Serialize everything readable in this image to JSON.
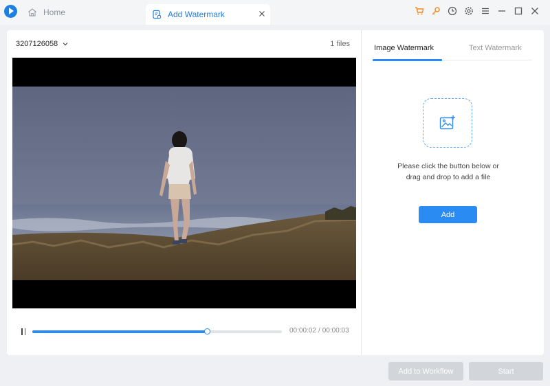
{
  "titlebar": {
    "home_tab": {
      "label": "Home",
      "icon": "home-icon"
    },
    "active_tab": {
      "label": "Add Watermark",
      "icon": "watermark-icon"
    },
    "icons": [
      "cart-icon",
      "key-icon",
      "clock-icon",
      "gear-icon",
      "menu-icon",
      "minimize-icon",
      "maximize-icon",
      "close-icon"
    ],
    "accent": "#f08a24"
  },
  "editor": {
    "file_name": "3207126058",
    "file_count": "1 files",
    "playback": {
      "progress": 0.7,
      "current_time": "00:00:02",
      "separator": "/",
      "total_time": "00:00:03"
    }
  },
  "watermark_panel": {
    "tabs": [
      {
        "label": "Image Watermark",
        "active": true
      },
      {
        "label": "Text Watermark",
        "active": false
      }
    ],
    "drop_text_1": "Please click the button below or",
    "drop_text_2": "drag and drop to add a file",
    "add_label": "Add"
  },
  "footer": {
    "workflow_label": "Add to Workflow",
    "start_label": "Start"
  },
  "colors": {
    "primary": "#2a8bf2",
    "disabled": "#d2d5d9"
  }
}
